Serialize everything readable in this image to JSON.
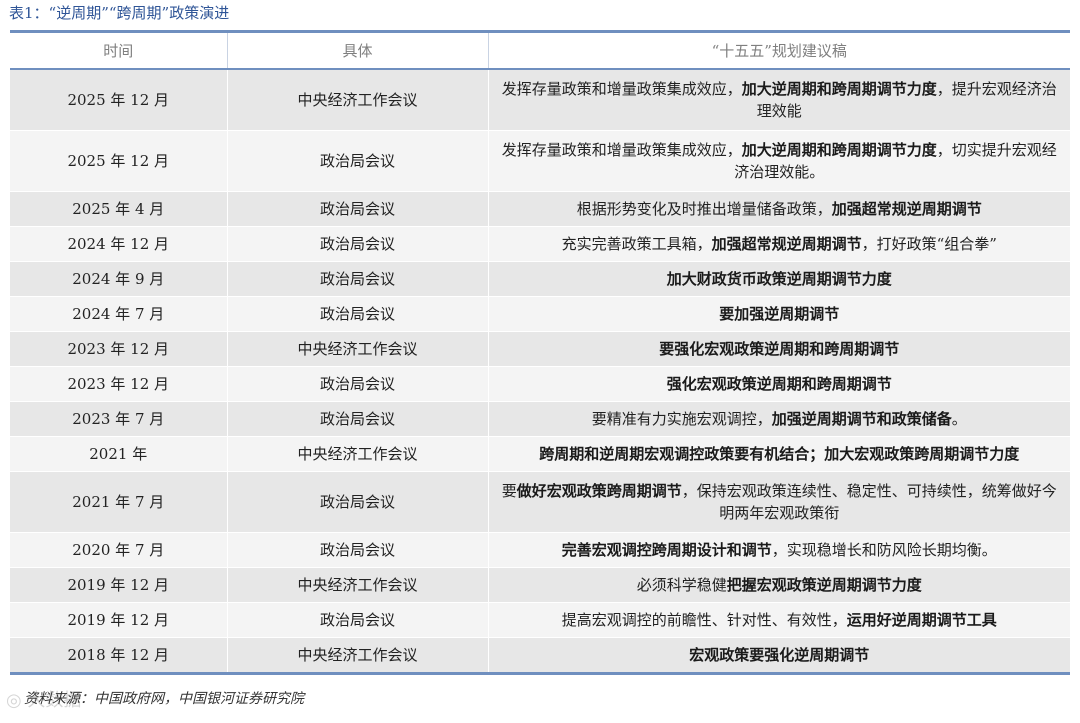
{
  "caption": "表1：“逆周期”“跨周期”政策演进",
  "headers": {
    "time": "时间",
    "body": "具体",
    "plan": "“十五五”规划建议稿"
  },
  "rows": [
    {
      "time": "2025 年 12 月",
      "body": "中央经济工作会议",
      "parts": [
        {
          "t": "发挥存量政策和增量政策集成效应，",
          "b": false
        },
        {
          "t": "加大逆周期和跨周期调节力度",
          "b": true
        },
        {
          "t": "，提升宏观经济治理效能",
          "b": false
        }
      ]
    },
    {
      "time": "2025 年 12 月",
      "body": "政治局会议",
      "parts": [
        {
          "t": "发挥存量政策和增量政策集成效应，",
          "b": false
        },
        {
          "t": "加大逆周期和跨周期调节力度",
          "b": true
        },
        {
          "t": "，切实提升宏观经济治理效能。",
          "b": false
        }
      ]
    },
    {
      "time": "2025 年 4 月",
      "body": "政治局会议",
      "parts": [
        {
          "t": "根据形势变化及时推出增量储备政策，",
          "b": false
        },
        {
          "t": "加强超常规逆周期调节",
          "b": true
        }
      ]
    },
    {
      "time": "2024 年 12 月",
      "body": "政治局会议",
      "parts": [
        {
          "t": "充实完善政策工具箱，",
          "b": false
        },
        {
          "t": "加强超常规逆周期调节",
          "b": true
        },
        {
          "t": "，打好政策“组合拳”",
          "b": false
        }
      ]
    },
    {
      "time": "2024 年 9 月",
      "body": "政治局会议",
      "parts": [
        {
          "t": "加大财政货币政策逆周期调节力度",
          "b": true
        }
      ]
    },
    {
      "time": "2024 年 7 月",
      "body": "政治局会议",
      "parts": [
        {
          "t": "要加强逆周期调节",
          "b": true
        }
      ]
    },
    {
      "time": "2023 年 12 月",
      "body": "中央经济工作会议",
      "parts": [
        {
          "t": "要强化宏观政策逆周期和跨周期调节",
          "b": true
        }
      ]
    },
    {
      "time": "2023 年 12 月",
      "body": "政治局会议",
      "parts": [
        {
          "t": "强化宏观政策逆周期和跨周期调节",
          "b": true
        }
      ]
    },
    {
      "time": "2023 年 7 月",
      "body": "政治局会议",
      "parts": [
        {
          "t": "要精准有力实施宏观调控，",
          "b": false
        },
        {
          "t": "加强逆周期调节和政策储备",
          "b": true
        },
        {
          "t": "。",
          "b": false
        }
      ]
    },
    {
      "time": "2021 年",
      "body": "中央经济工作会议",
      "parts": [
        {
          "t": "跨周期和逆周期宏观调控政策要有机结合；加大宏观政策跨周期调节力度",
          "b": true
        }
      ]
    },
    {
      "time": "2021 年 7 月",
      "body": "政治局会议",
      "parts": [
        {
          "t": "要",
          "b": false
        },
        {
          "t": "做好宏观政策跨周期调节",
          "b": true
        },
        {
          "t": "，保持宏观政策连续性、稳定性、可持续性，统筹做好今明两年宏观政策衔",
          "b": false
        }
      ]
    },
    {
      "time": "2020 年 7 月",
      "body": "政治局会议",
      "parts": [
        {
          "t": "完善宏观调控跨周期设计和调节",
          "b": true
        },
        {
          "t": "，实现稳增长和防风险长期均衡。",
          "b": false
        }
      ]
    },
    {
      "time": "2019 年 12 月",
      "body": "中央经济工作会议",
      "parts": [
        {
          "t": "必须科学稳健",
          "b": false
        },
        {
          "t": "把握宏观政策逆周期调节力度",
          "b": true
        }
      ]
    },
    {
      "time": "2019 年 12 月",
      "body": "政治局会议",
      "parts": [
        {
          "t": "提高宏观调控的前瞻性、针对性、有效性，",
          "b": false
        },
        {
          "t": "运用好逆周期调节工具",
          "b": true
        }
      ]
    },
    {
      "time": "2018 年 12 月",
      "body": "中央经济工作会议",
      "parts": [
        {
          "t": "宏观政策要强化逆周期调节",
          "b": true
        }
      ]
    }
  ],
  "source": "资料来源：中国政府网，中国银河证券研究院",
  "watermark": "◎ 大数据"
}
